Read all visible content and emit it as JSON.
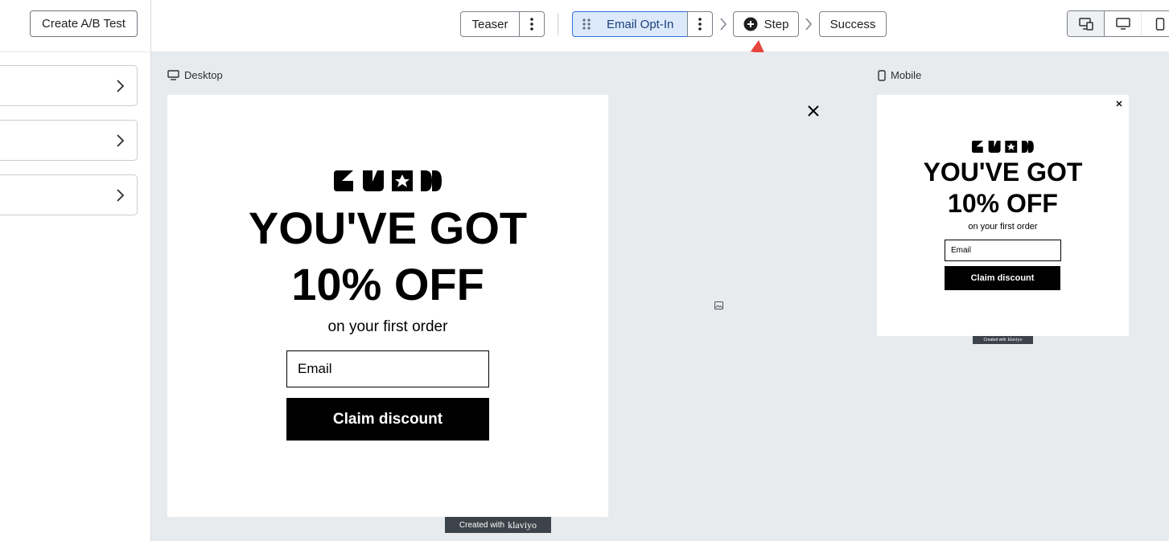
{
  "left_panel": {
    "ab_test_button": "Create A/B Test"
  },
  "steps": {
    "teaser": "Teaser",
    "email_optin": "Email Opt-In",
    "add_step": "Step",
    "success": "Success"
  },
  "canvas": {
    "desktop_label": "Desktop",
    "mobile_label": "Mobile"
  },
  "popup": {
    "headline_line1": "YOU'VE GOT",
    "headline_line2": "10% OFF",
    "subtext": "on your first order",
    "email_placeholder": "Email",
    "cta": "Claim discount",
    "badge_prefix": "Created with",
    "badge_brand": "klaviyo"
  },
  "colors": {
    "active_step_bg": "#dbe9fb",
    "active_step_border": "#2f6fd8",
    "active_step_text": "#1b3f7a",
    "annotation_arrow": "#e5453a",
    "canvas_bg": "#e8ebee"
  },
  "icons": {
    "close": "close-icon",
    "desktop": "desktop-icon",
    "mobile": "mobile-icon",
    "image_placeholder": "image-icon"
  }
}
